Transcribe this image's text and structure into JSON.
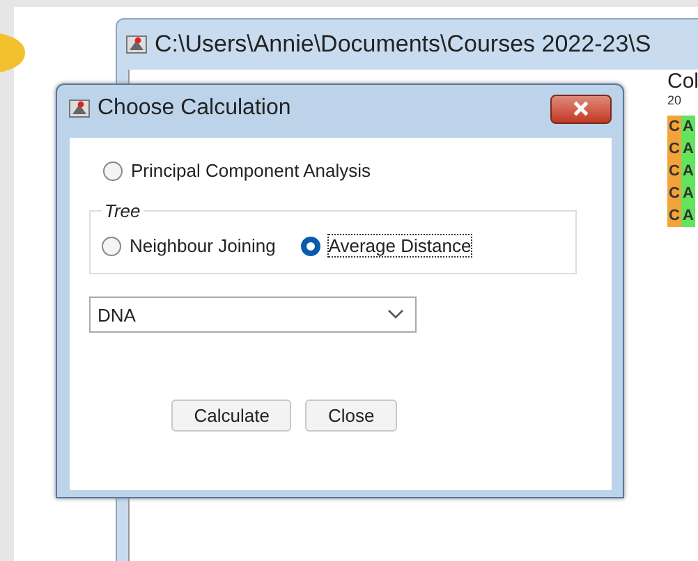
{
  "back_window": {
    "title": "C:\\Users\\Annie\\Documents\\Courses 2022-23\\S",
    "column_label": "Col",
    "ruler": "20",
    "rows": [
      [
        {
          "base": "C",
          "color": "#f4a33a"
        },
        {
          "base": "A",
          "color": "#63e45a"
        }
      ],
      [
        {
          "base": "C",
          "color": "#f4a33a"
        },
        {
          "base": "A",
          "color": "#63e45a"
        }
      ],
      [
        {
          "base": "C",
          "color": "#f4a33a"
        },
        {
          "base": "A",
          "color": "#63e45a"
        }
      ],
      [
        {
          "base": "C",
          "color": "#f4a33a"
        },
        {
          "base": "A",
          "color": "#63e45a"
        }
      ],
      [
        {
          "base": "C",
          "color": "#f4a33a"
        },
        {
          "base": "A",
          "color": "#63e45a"
        }
      ]
    ]
  },
  "dialog": {
    "title": "Choose Calculation",
    "options": [
      {
        "label": "Principal Component Analysis",
        "selected": false
      }
    ],
    "tree_group": {
      "legend": "Tree",
      "options": [
        {
          "label": "Neighbour Joining",
          "selected": false,
          "focused": false
        },
        {
          "label": "Average Distance",
          "selected": true,
          "focused": true
        }
      ]
    },
    "dropdown": {
      "value": "DNA"
    },
    "buttons": [
      "Calculate",
      "Close"
    ]
  }
}
